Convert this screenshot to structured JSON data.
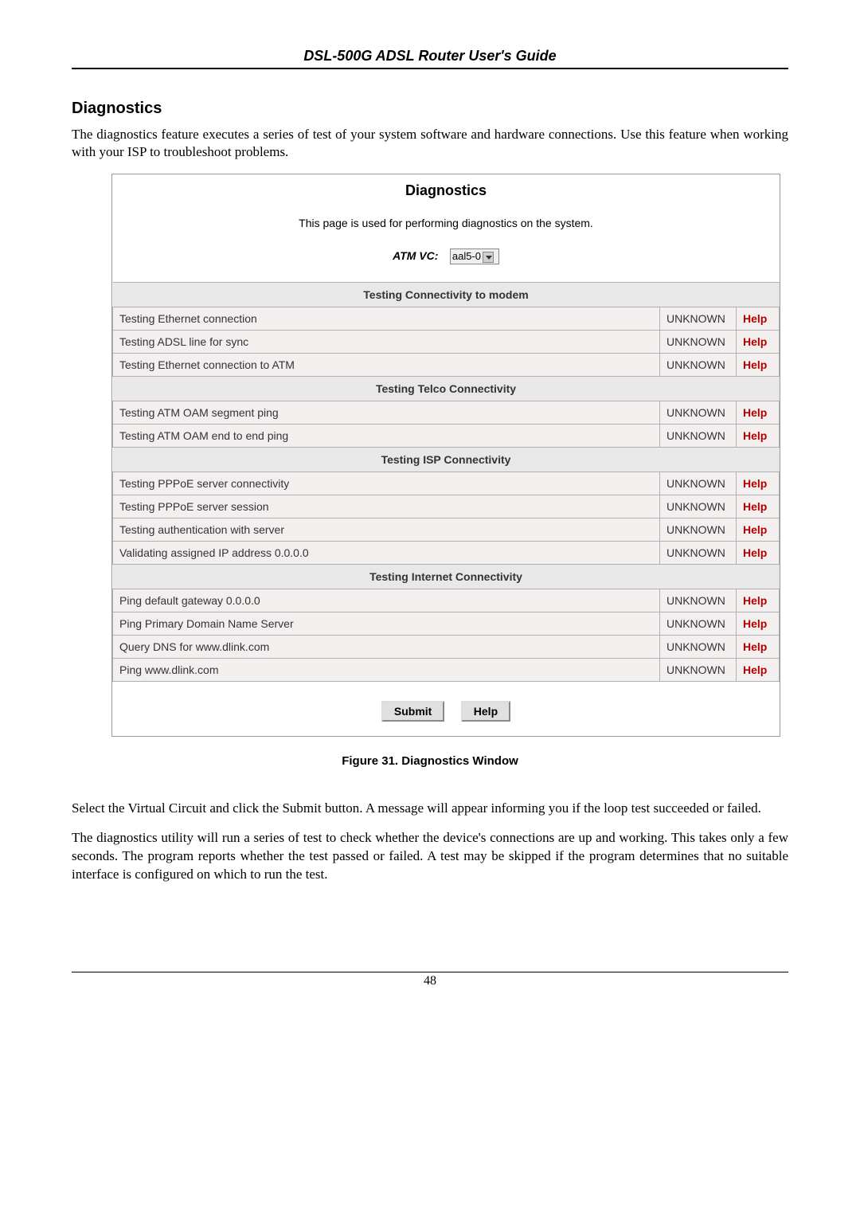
{
  "header": {
    "title": "DSL-500G ADSL Router User's Guide"
  },
  "section": {
    "heading": "Diagnostics",
    "intro": "The diagnostics feature executes a series of test of your system software and hardware connections. Use this feature when working with your ISP to troubleshoot problems."
  },
  "panel": {
    "title": "Diagnostics",
    "description": "This page is used for performing diagnostics on the system.",
    "atm_label": "ATM VC:",
    "atm_value": "aal5-0",
    "sections": [
      {
        "header": "Testing Connectivity to modem",
        "rows": [
          {
            "test": "Testing Ethernet connection",
            "status": "UNKNOWN",
            "help": "Help"
          },
          {
            "test": "Testing ADSL line for sync",
            "status": "UNKNOWN",
            "help": "Help"
          },
          {
            "test": "Testing Ethernet connection to ATM",
            "status": "UNKNOWN",
            "help": "Help"
          }
        ]
      },
      {
        "header": "Testing Telco Connectivity",
        "rows": [
          {
            "test": "Testing ATM OAM segment ping",
            "status": "UNKNOWN",
            "help": "Help"
          },
          {
            "test": "Testing ATM OAM end to end ping",
            "status": "UNKNOWN",
            "help": "Help"
          }
        ]
      },
      {
        "header": "Testing ISP Connectivity",
        "rows": [
          {
            "test": "Testing PPPoE server connectivity",
            "status": "UNKNOWN",
            "help": "Help"
          },
          {
            "test": "Testing PPPoE server session",
            "status": "UNKNOWN",
            "help": "Help"
          },
          {
            "test": "Testing authentication with server",
            "status": "UNKNOWN",
            "help": "Help"
          },
          {
            "test": "Validating assigned IP address 0.0.0.0",
            "status": "UNKNOWN",
            "help": "Help"
          }
        ]
      },
      {
        "header": "Testing Internet Connectivity",
        "rows": [
          {
            "test": "Ping default gateway 0.0.0.0",
            "status": "UNKNOWN",
            "help": "Help"
          },
          {
            "test": "Ping Primary Domain Name Server",
            "status": "UNKNOWN",
            "help": "Help"
          },
          {
            "test": "Query DNS for www.dlink.com",
            "status": "UNKNOWN",
            "help": "Help"
          },
          {
            "test": "Ping www.dlink.com",
            "status": "UNKNOWN",
            "help": "Help"
          }
        ]
      }
    ],
    "buttons": {
      "submit": "Submit",
      "help": "Help"
    }
  },
  "figure_caption": "Figure 31. Diagnostics Window",
  "paragraphs": {
    "p1": "Select the Virtual Circuit and click the Submit button. A message will appear informing you if the loop test succeeded or failed.",
    "p2": "The diagnostics utility will run a series of test to check whether the device's connections are up and working. This takes only a few seconds. The program reports whether the test passed or failed. A test may be skipped if the program determines that no suitable interface is configured on which to run the test."
  },
  "footer": {
    "page_number": "48"
  }
}
